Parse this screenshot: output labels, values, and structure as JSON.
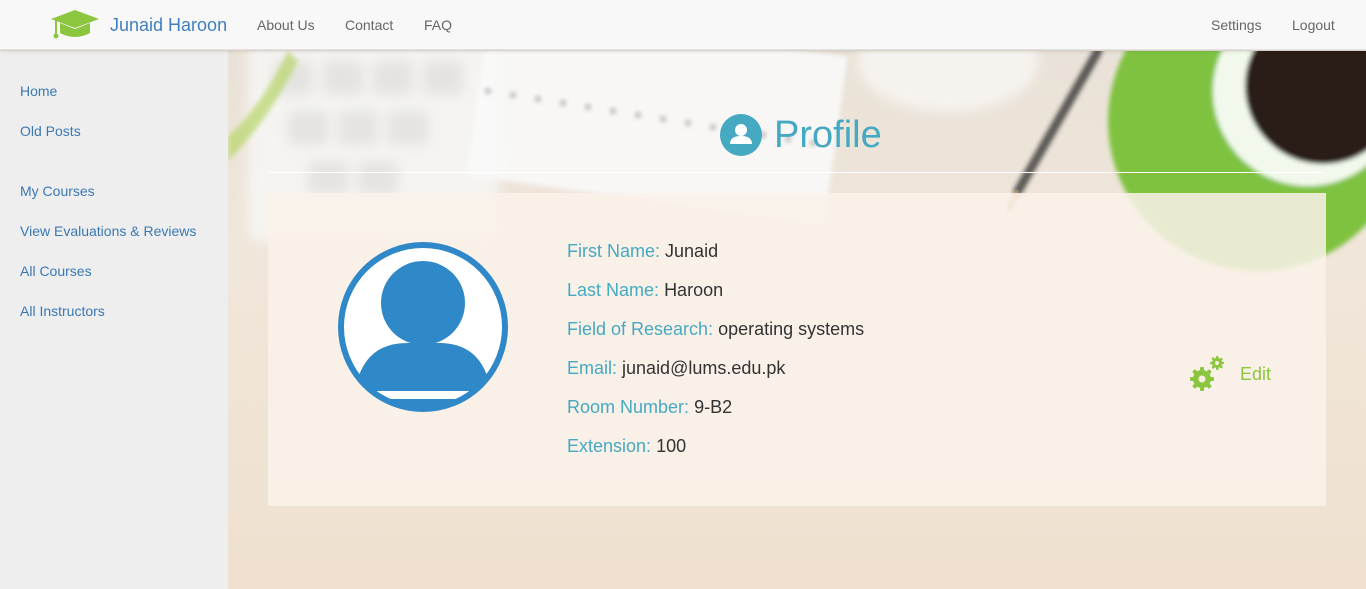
{
  "navbar": {
    "brand": "Junaid Haroon",
    "links": [
      "About Us",
      "Contact",
      "FAQ"
    ],
    "right_links": [
      "Settings",
      "Logout"
    ],
    "brand_icon": "graduation-cap-icon"
  },
  "sidebar": {
    "items": [
      {
        "label": "Home"
      },
      {
        "label": "Old Posts"
      },
      {
        "label": "My Courses"
      },
      {
        "label": "View Evaluations & Reviews"
      },
      {
        "label": "All Courses"
      },
      {
        "label": "All Instructors"
      }
    ]
  },
  "main": {
    "title": "Profile",
    "title_icon": "user-circle-icon",
    "fields": [
      {
        "label": "First Name:",
        "value": "Junaid"
      },
      {
        "label": "Last Name:",
        "value": "Haroon"
      },
      {
        "label": "Field of Research:",
        "value": "operating systems"
      },
      {
        "label": "Email:",
        "value": "junaid@lums.edu.pk"
      },
      {
        "label": "Room Number:",
        "value": "9-B2"
      },
      {
        "label": "Extension:",
        "value": "100"
      }
    ],
    "edit_label": "Edit",
    "edit_icon": "gears-icon",
    "avatar_icon": "user-avatar-icon"
  },
  "colors": {
    "accent": "#46a9c2",
    "link": "#3a78b4",
    "brand": "#3f7fbf",
    "edit": "#8cc63f",
    "avatar": "#2f88c8"
  }
}
